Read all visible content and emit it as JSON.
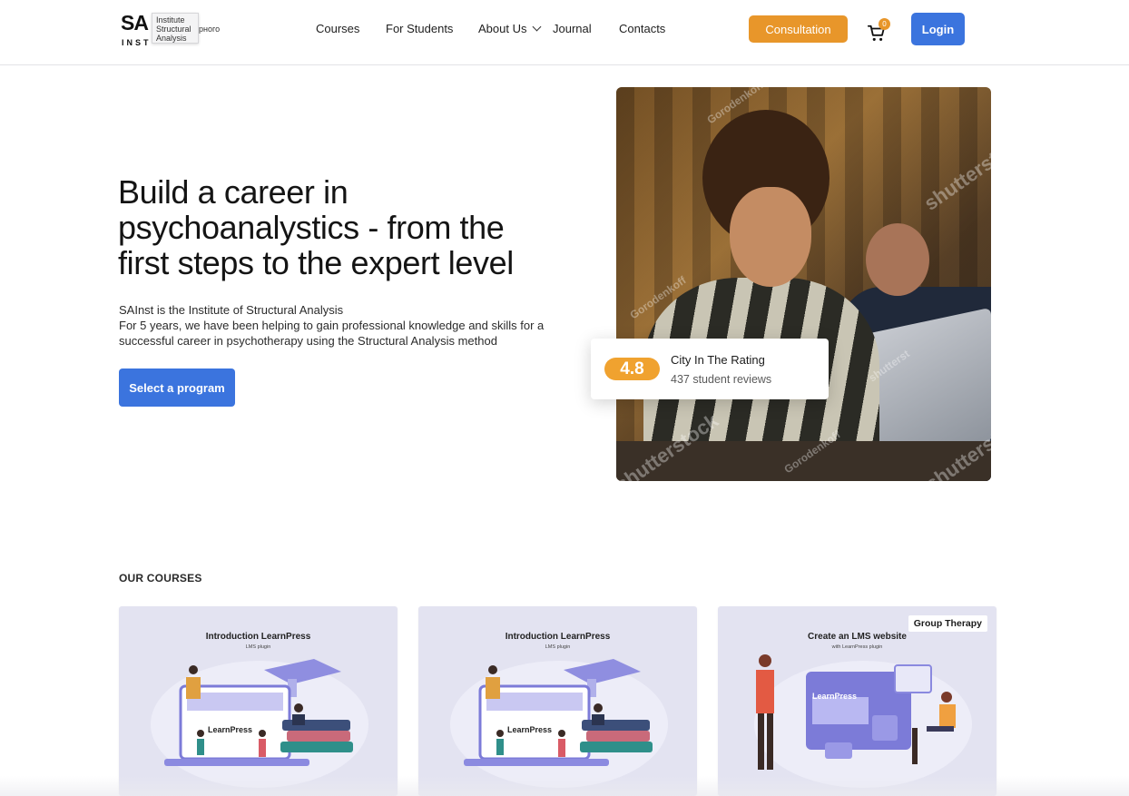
{
  "header": {
    "logo": {
      "mark": "SA",
      "mark_sub": "INST",
      "tooltip": [
        "Institute",
        "Structural",
        "Analysis"
      ],
      "tail_text": "рного"
    },
    "nav": [
      {
        "label": "Courses"
      },
      {
        "label": "For Students"
      },
      {
        "label": "About Us",
        "has_dropdown": true
      },
      {
        "label": "Journal"
      },
      {
        "label": "Contacts"
      }
    ],
    "consultation_label": "Consultation",
    "cart_count": "0",
    "login_label": "Login",
    "colors": {
      "accent_orange": "#e8962a",
      "primary_blue": "#3b74de"
    }
  },
  "hero": {
    "title": "Build a career in psychoanalystics - from the first steps to the expert level",
    "description_lines": [
      "SAInst is the Institute of Structural Analysis",
      "For 5 years, we have been helping to gain professional knowledge and skills for a",
      "successful career in psychotherapy using the Structural Analysis method"
    ],
    "cta_label": "Select a program",
    "image_watermarks": [
      "Gorodenkoff",
      "shutterstock",
      "Gorodenkoff",
      "shutterst",
      "shutterstock",
      "Gorodenkoff",
      "shutterst"
    ],
    "rating": {
      "value": "4.8",
      "title": "City In The Rating",
      "subtitle": "437 student reviews"
    }
  },
  "courses": {
    "heading": "OUR COURSES",
    "cards": [
      {
        "title": "Introduction LearnPress",
        "subtitle": "LMS plugin",
        "inner_label": "LearnPress",
        "tag": ""
      },
      {
        "title": "Introduction LearnPress",
        "subtitle": "LMS plugin",
        "inner_label": "LearnPress",
        "tag": ""
      },
      {
        "title": "Create an LMS website",
        "subtitle": "with LearnPress plugin",
        "inner_label": "LearnPress",
        "tag": "Group Therapy"
      }
    ]
  }
}
